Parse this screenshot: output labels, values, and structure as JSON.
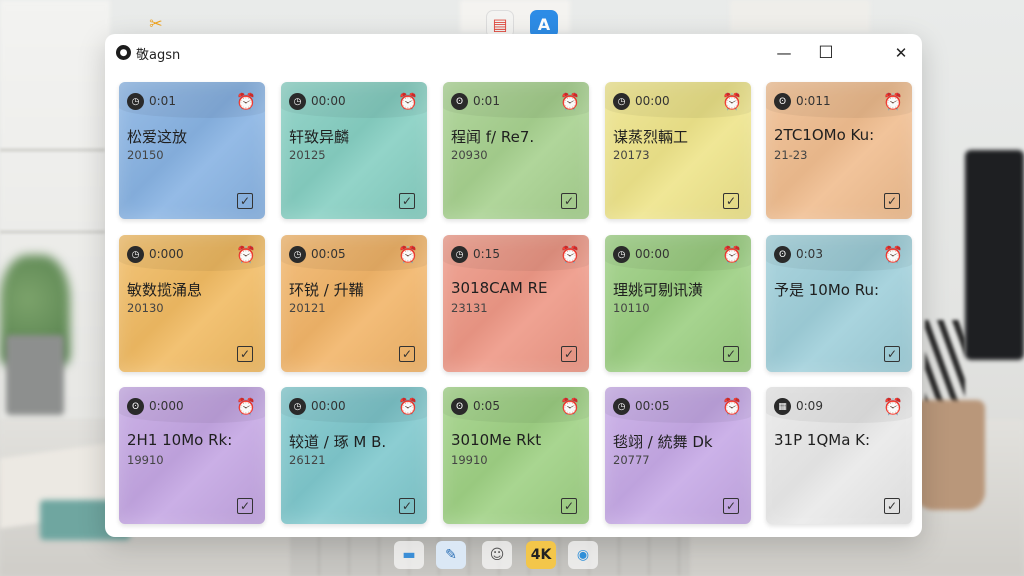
{
  "window": {
    "title": "敬agsn",
    "controls": {
      "minimize_icon": "—",
      "maximize_icon": "☐",
      "close_icon": "✕"
    }
  },
  "notes": [
    {
      "time": "0:01",
      "title": "松爱这放",
      "sub": "20150",
      "color": "#88b3e3",
      "icon": "clock-icon"
    },
    {
      "time": "00:00",
      "title": "轩致异麟",
      "sub": "20125",
      "color": "#86cfc2",
      "icon": "clock-icon"
    },
    {
      "time": "0:01",
      "title": "程闻 f/ Re7.",
      "sub": "20930",
      "color": "#a7d18f",
      "icon": "bear-icon"
    },
    {
      "time": "00:00",
      "title": "谋蒸烈輛工",
      "sub": "20173",
      "color": "#eee48a",
      "icon": "clock-icon"
    },
    {
      "time": "0:011",
      "title": "2TC1OMo Ku:",
      "sub": "21-23",
      "color": "#f0bd8f",
      "icon": "bear-icon"
    },
    {
      "time": "0:000",
      "title": "敏数揽涌息",
      "sub": "20130",
      "color": "#f1bb63",
      "icon": "clock-icon"
    },
    {
      "time": "00:05",
      "title": "环锐 / 升鞴",
      "sub": "20121",
      "color": "#f2b569",
      "icon": "clock-icon"
    },
    {
      "time": "0:15",
      "title": "3018CAM RE",
      "sub": "23131",
      "color": "#ee9886",
      "icon": "clock-icon"
    },
    {
      "time": "00:00",
      "title": "理姚可剔讯潢",
      "sub": "10110",
      "color": "#9ccf82",
      "icon": "clock-icon"
    },
    {
      "time": "0:03",
      "title": "予是 10Mo Ru:",
      "sub": "",
      "color": "#9fcfda",
      "icon": "bear-icon"
    },
    {
      "time": "0:000",
      "title": "2H1 10Mo Rk:",
      "sub": "19910",
      "color": "#c4a6e3",
      "icon": "bear-icon"
    },
    {
      "time": "00:00",
      "title": "较道 / 琢 M B.",
      "sub": "26121",
      "color": "#7fc8cd",
      "icon": "clock-icon"
    },
    {
      "time": "0:05",
      "title": "3010Me Rkt",
      "sub": "19910",
      "color": "#9fd184",
      "icon": "bear-icon"
    },
    {
      "time": "00:05",
      "title": "毯翊 / 統舞 Dk",
      "sub": "20777",
      "color": "#c6a9e6",
      "icon": "clock-icon"
    },
    {
      "time": "0:09",
      "title": "31P 1QMa K:",
      "sub": "",
      "color": "#e9e9e9",
      "icon": "calendar-icon"
    }
  ],
  "taskbar": [
    {
      "name": "taskbar-window-icon",
      "glyph": "▬",
      "color": "#3b8ed6"
    },
    {
      "name": "taskbar-notes-icon",
      "glyph": "✎",
      "color": "#2b6fb5"
    },
    {
      "name": "taskbar-face-icon",
      "glyph": "☺",
      "color": "#555555"
    },
    {
      "name": "taskbar-4k-icon",
      "glyph": "4K",
      "color": "#e0a427"
    },
    {
      "name": "taskbar-globe-icon",
      "glyph": "◉",
      "color": "#2f8fd8"
    }
  ]
}
